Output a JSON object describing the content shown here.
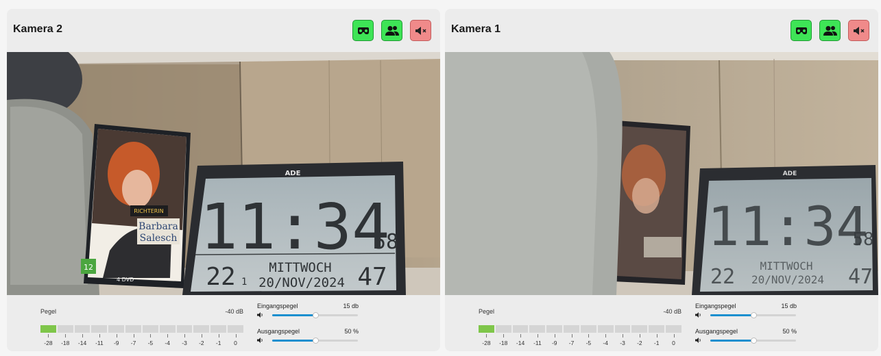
{
  "panels": [
    {
      "title": "Kamera 2",
      "buttons": [
        {
          "icon": "mask-icon",
          "color": "green"
        },
        {
          "icon": "users-icon",
          "color": "green"
        },
        {
          "icon": "speaker-muted-icon",
          "color": "red"
        }
      ],
      "video": {
        "brand": "ADE",
        "clock_time": "11:34",
        "clock_seconds": "58",
        "clock_temp": "22",
        "clock_temp_decimal": "1",
        "clock_day": "MITTWOCH",
        "clock_date": "20/NOV/2024",
        "clock_humidity": "47",
        "dvd_name_first": "Barbara",
        "dvd_name_last": "Salesch",
        "dvd_role": "RICHTERIN",
        "dvd_label": "4 DVD",
        "dvd_rating": "12"
      },
      "level": {
        "label": "Pegel",
        "db": "-40 dB",
        "active_segments": 1,
        "scale": [
          "-28",
          "-18",
          "-14",
          "-11",
          "-9",
          "-7",
          "-5",
          "-4",
          "-3",
          "-2",
          "-1",
          "0"
        ]
      },
      "input": {
        "label": "Eingangspegel",
        "value": "15 db",
        "fraction": 0.5
      },
      "output": {
        "label": "Ausgangspegel",
        "value": "50 %",
        "fraction": 0.5
      }
    },
    {
      "title": "Kamera 1",
      "buttons": [
        {
          "icon": "mask-icon",
          "color": "green"
        },
        {
          "icon": "users-icon",
          "color": "green"
        },
        {
          "icon": "speaker-muted-icon",
          "color": "red"
        }
      ],
      "video": {
        "brand": "ADE",
        "clock_time": "11:34",
        "clock_seconds": "58",
        "clock_temp": "22",
        "clock_temp_decimal": "",
        "clock_day": "MITTWOCH",
        "clock_date": "20/NOV/2024",
        "clock_humidity": "47",
        "dvd_name_first": "",
        "dvd_name_last": "",
        "dvd_role": "",
        "dvd_label": "",
        "dvd_rating": ""
      },
      "level": {
        "label": "Pegel",
        "db": "-40 dB",
        "active_segments": 1,
        "scale": [
          "-28",
          "-18",
          "-14",
          "-11",
          "-9",
          "-7",
          "-5",
          "-4",
          "-3",
          "-2",
          "-1",
          "0"
        ]
      },
      "input": {
        "label": "Eingangspegel",
        "value": "15 db",
        "fraction": 0.5
      },
      "output": {
        "label": "Ausgangspegel",
        "value": "50 %",
        "fraction": 0.5
      }
    }
  ],
  "colors": {
    "button_green": "#3ee456",
    "button_red": "#f08a8a",
    "meter_active": "#7fc64a",
    "slider_fill": "#1a8fcf"
  }
}
